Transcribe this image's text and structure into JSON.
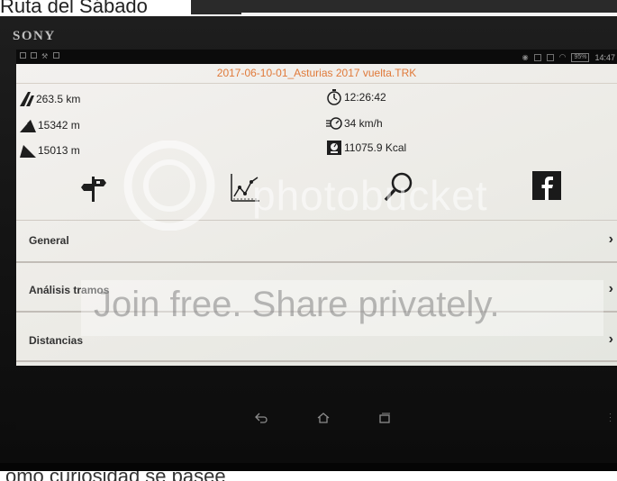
{
  "web_page": {
    "title": "Ruta del Sábado",
    "caption": "omo curiosidad se pasee"
  },
  "device": {
    "brand": "SONY",
    "status_time": "14:47",
    "battery": "95%"
  },
  "app": {
    "file_title": "2017-06-10-01_Asturias 2017 vuelta.TRK",
    "stats": {
      "distance": "263.5 km",
      "ascent": "15342 m",
      "descent": "15013 m",
      "duration": "12:26:42",
      "speed": "34 km/h",
      "calories": "11075.9 Kcal"
    },
    "actions": [
      {
        "icon": "signpost-icon"
      },
      {
        "icon": "line-chart-icon"
      },
      {
        "icon": "magnifier-icon"
      },
      {
        "icon": "facebook-icon"
      }
    ],
    "rows": [
      {
        "label": "General"
      },
      {
        "label": "Análisis tramos"
      },
      {
        "label": "Distancias"
      }
    ],
    "chevron": "›",
    "colors": {
      "accent_orange": "#e07a3a",
      "toolbar_blue": "#2f7fd0"
    }
  },
  "watermark": {
    "brand_text": "photobucket",
    "slogan": "Join free. Share privately."
  }
}
